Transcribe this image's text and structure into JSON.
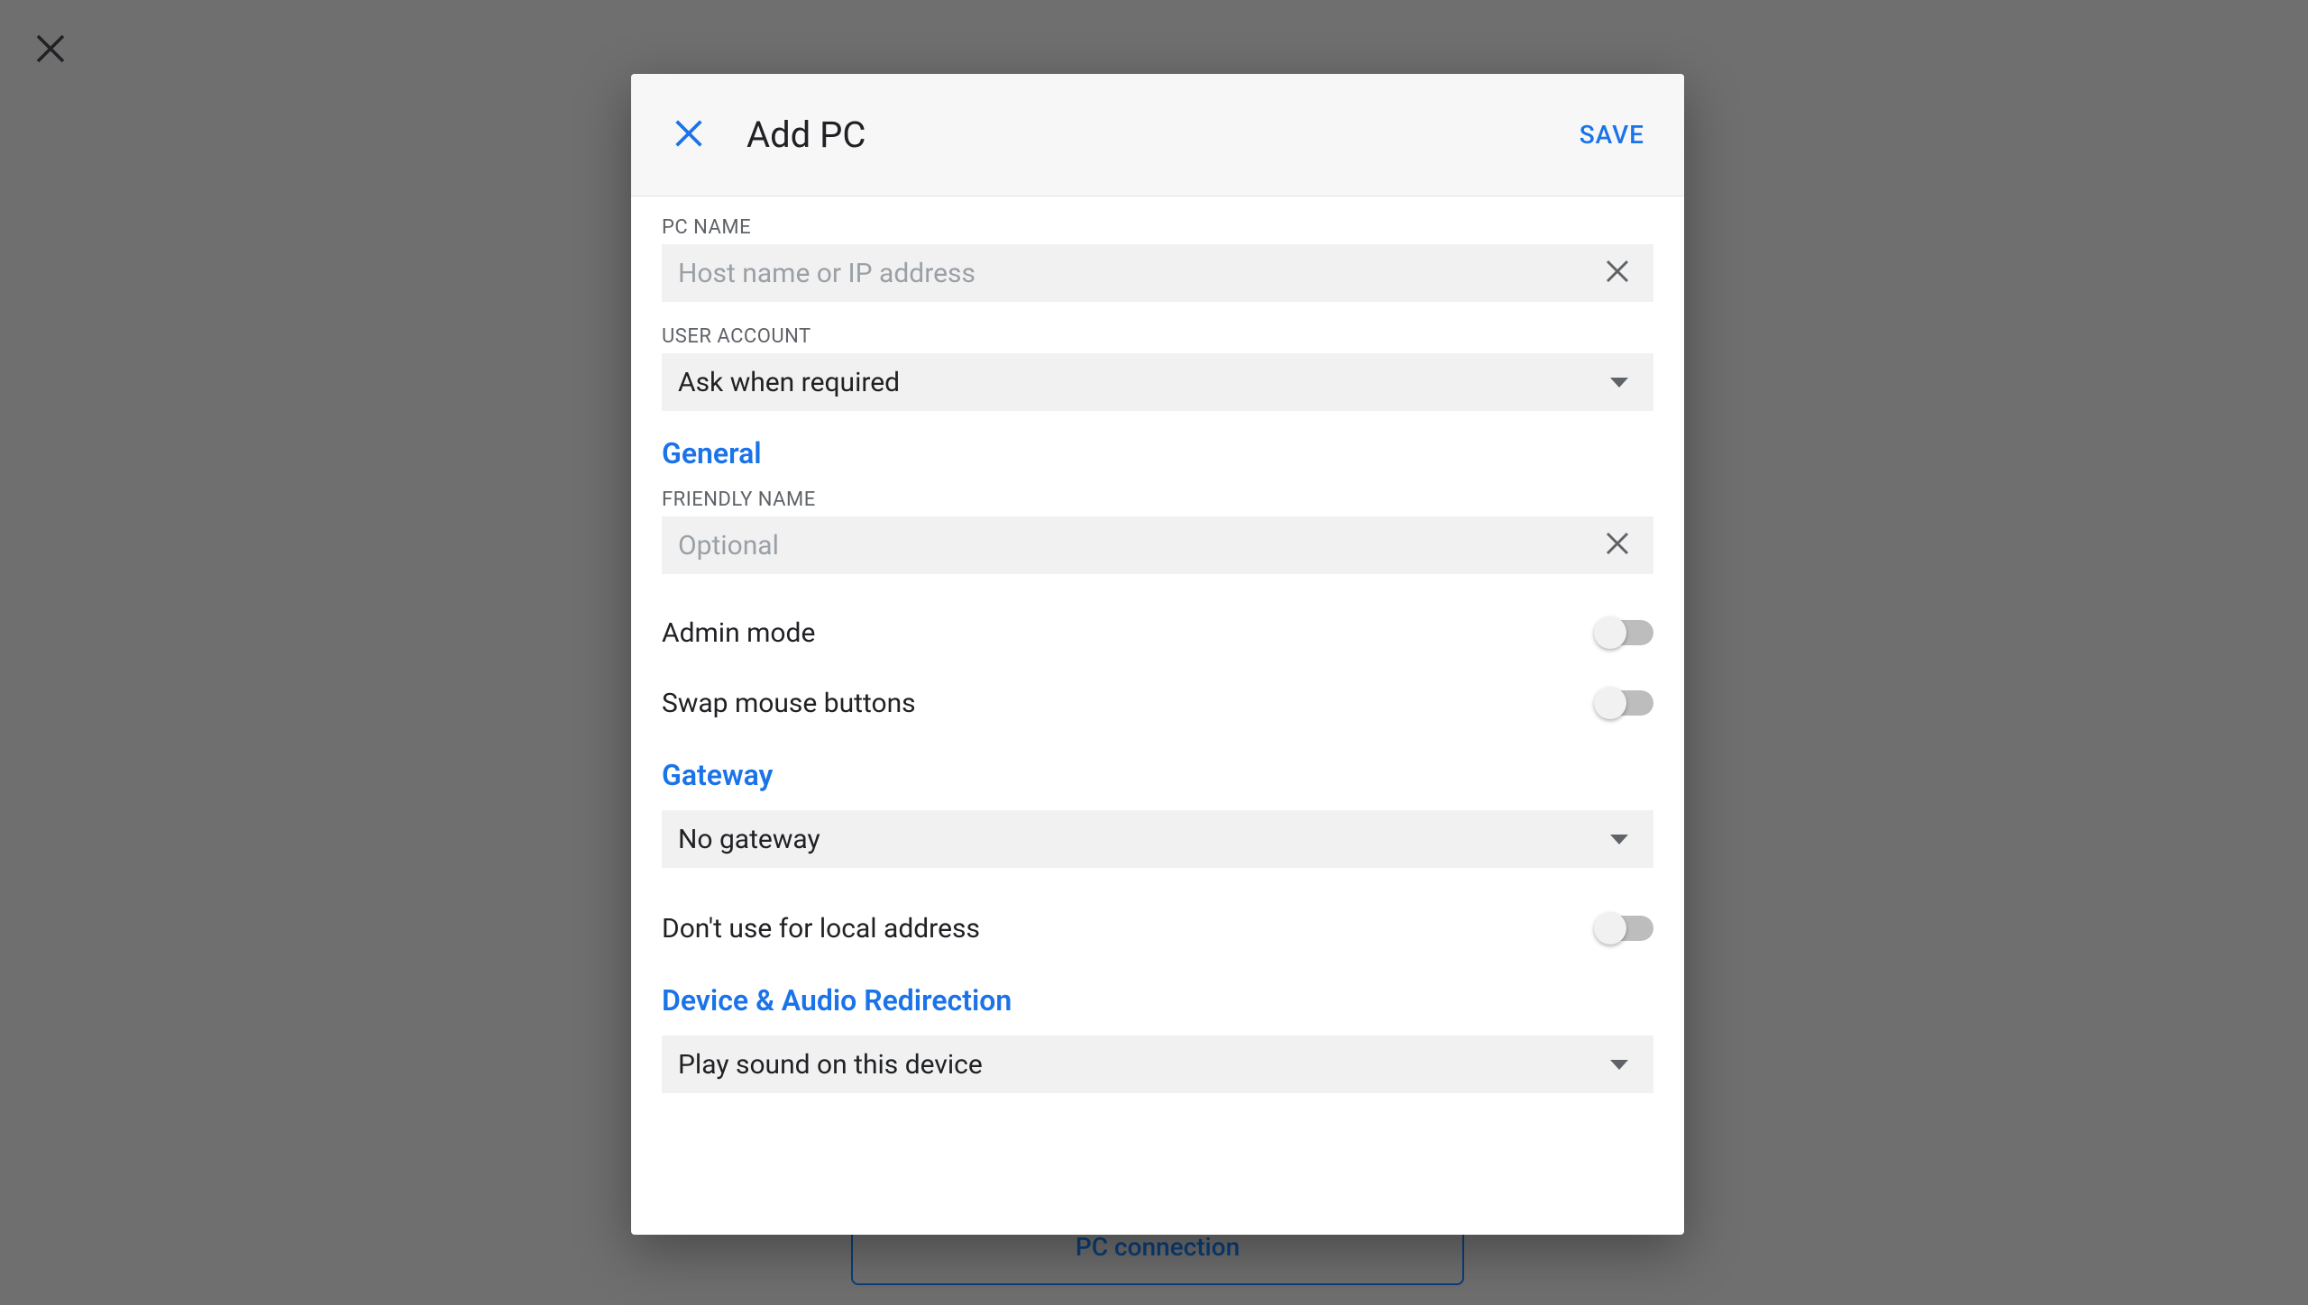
{
  "backdrop": {
    "pc_connection_label": "PC connection"
  },
  "modal": {
    "title": "Add PC",
    "save_label": "SAVE",
    "pc_name": {
      "label": "PC NAME",
      "placeholder": "Host name or IP address",
      "value": ""
    },
    "user_account": {
      "label": "USER ACCOUNT",
      "value": "Ask when required"
    },
    "sections": {
      "general": {
        "title": "General",
        "friendly_name": {
          "label": "FRIENDLY NAME",
          "placeholder": "Optional",
          "value": ""
        },
        "admin_mode": {
          "label": "Admin mode",
          "on": false
        },
        "swap_mouse": {
          "label": "Swap mouse buttons",
          "on": false
        }
      },
      "gateway": {
        "title": "Gateway",
        "select_value": "No gateway",
        "dont_use_local": {
          "label": "Don't use for local address",
          "on": false
        }
      },
      "device_audio": {
        "title": "Device & Audio Redirection",
        "select_value": "Play sound on this device"
      }
    }
  },
  "colors": {
    "accent": "#1a73e8",
    "label_grey": "#5f6368",
    "field_bg": "#f1f1f1"
  }
}
